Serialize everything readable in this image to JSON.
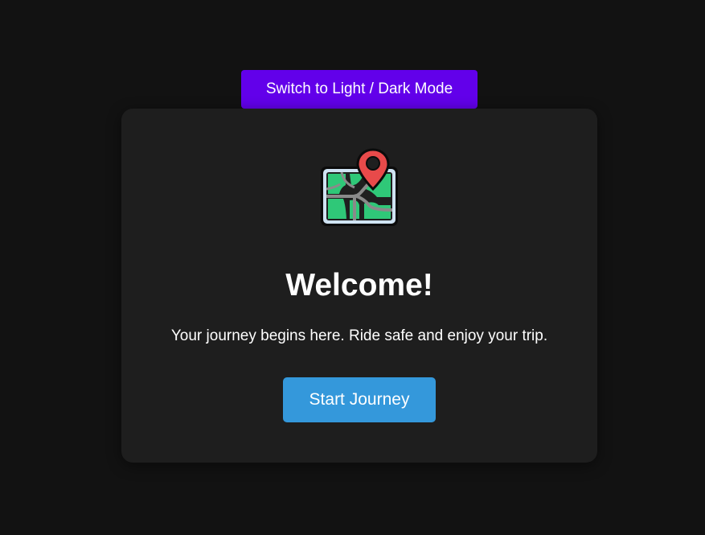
{
  "header": {
    "theme_toggle_label": "Switch to Light / Dark Mode"
  },
  "card": {
    "icon": "map-pin-icon",
    "title": "Welcome!",
    "subtitle": "Your journey begins here. Ride safe and enjoy your trip.",
    "start_button_label": "Start Journey"
  },
  "colors": {
    "page_background": "#121212",
    "card_background": "#1e1e1e",
    "toggle_button": "#6200ea",
    "start_button": "#3498db",
    "map_green": "#2ecc71",
    "pin_red": "#e74c3c"
  }
}
